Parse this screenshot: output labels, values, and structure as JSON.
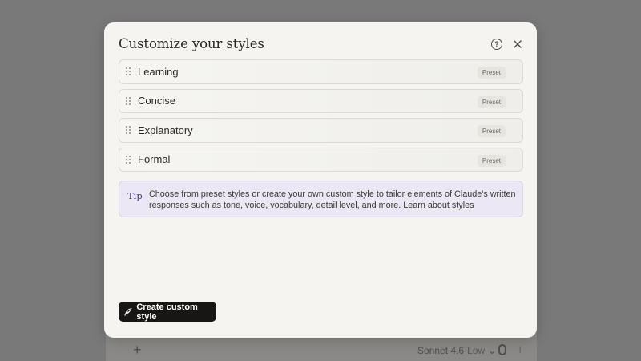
{
  "background": {
    "model_name": "Sonnet 4.6",
    "effort": "Low"
  },
  "modal": {
    "title": "Customize your styles",
    "help_glyph": "?",
    "styles": [
      {
        "name": "Learning",
        "badge": "Preset"
      },
      {
        "name": "Concise",
        "badge": "Preset"
      },
      {
        "name": "Explanatory",
        "badge": "Preset"
      },
      {
        "name": "Formal",
        "badge": "Preset"
      }
    ],
    "tip": {
      "label": "Tip",
      "text": "Choose from preset styles or create your own custom style to tailor elements of Claude's written responses such as tone, voice, vocabulary, detail level, and more.",
      "link": "Learn about styles"
    },
    "create_button": "Create custom style"
  },
  "colors": {
    "overlay": "#797979",
    "modal_bg": "#f5f4f0",
    "tip_bg": "#ebe7f4",
    "tip_label": "#3d3a79",
    "button_bg": "#171614"
  },
  "icons": {
    "help": "help-circle-icon",
    "close": "close-icon",
    "drag": "drag-handle-icon",
    "create": "feather-pen-icon"
  }
}
